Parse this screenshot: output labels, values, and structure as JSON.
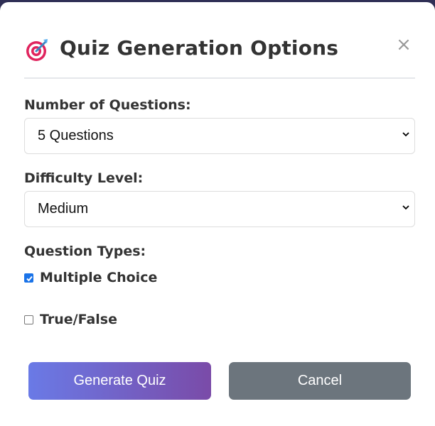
{
  "dialog": {
    "title": "Quiz Generation Options",
    "close_label": "×",
    "icon": "target-dart-icon"
  },
  "fields": {
    "num_questions": {
      "label": "Number of Questions:",
      "value": "5 Questions"
    },
    "difficulty": {
      "label": "Difficulty Level:",
      "value": "Medium"
    },
    "question_types": {
      "label": "Question Types:",
      "options": [
        {
          "label": "Multiple Choice",
          "checked": true
        },
        {
          "label": "True/False",
          "checked": false
        }
      ]
    }
  },
  "buttons": {
    "generate_label": "Generate Quiz",
    "cancel_label": "Cancel"
  },
  "colors": {
    "primary_gradient_start": "#6a7ae6",
    "primary_gradient_end": "#7a4ba8",
    "cancel": "#6c757d",
    "checkbox_checked": "#1a73e8"
  }
}
